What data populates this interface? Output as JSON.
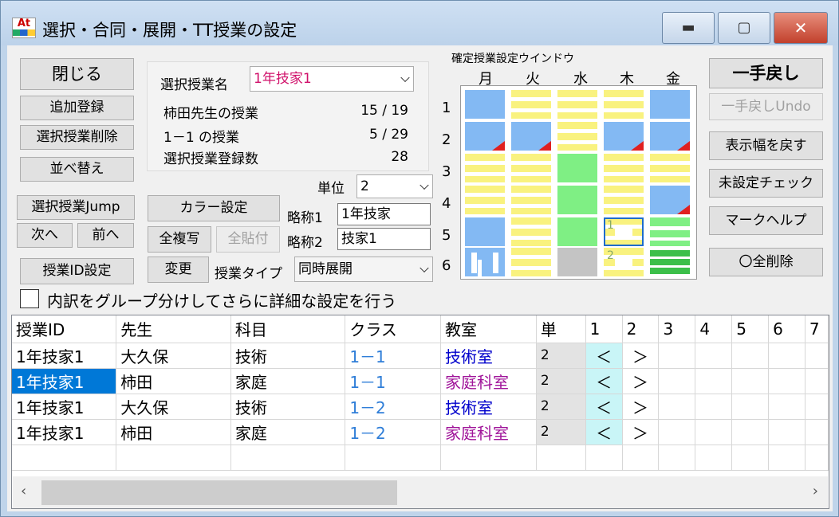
{
  "window": {
    "title": "選択・合同・展開・TT授業の設定",
    "app_icon_text": "At"
  },
  "left_buttons": {
    "close": "閉じる",
    "add": "追加登録",
    "delete": "選択授業削除",
    "sort": "並べ替え",
    "jump": "選択授業Jump",
    "next": "次へ",
    "prev": "前へ",
    "id_setting": "授業ID設定"
  },
  "info": {
    "select_label": "選択授業名",
    "select_value": "1年技家1",
    "row1_label": "柿田先生の授業",
    "row1_value": "15 / 19",
    "row2_label": "1－1 の授業",
    "row2_value": "5 / 29",
    "row3_label": "選択授業登録数",
    "row3_value": "28"
  },
  "mid": {
    "color_btn": "カラー設定",
    "copy_all": "全複写",
    "paste_all": "全貼付",
    "change": "変更",
    "unit_label": "単位",
    "unit_value": "2",
    "abbr1_label": "略称1",
    "abbr1_value": "1年技家",
    "abbr2_label": "略称2",
    "abbr2_value": "技家1",
    "type_label": "授業タイプ",
    "type_value": "同時展開"
  },
  "grid": {
    "title": "確定授業設定ウインドウ",
    "days": [
      "月",
      "火",
      "水",
      "木",
      "金"
    ],
    "periods": [
      "1",
      "2",
      "3",
      "4",
      "5",
      "6"
    ],
    "sel_labels": [
      "1",
      "2"
    ]
  },
  "right_buttons": {
    "undo": "一手戻し",
    "undo_undo": "一手戻しUndo",
    "reset_width": "表示幅を戻す",
    "check": "未設定チェック",
    "mark_help": "マークヘルプ",
    "clear_all": "〇全削除"
  },
  "checkbox_label": "内訳をグループ分けしてさらに詳細な設定を行う",
  "table": {
    "headers": [
      "授業ID",
      "先生",
      "科目",
      "クラス",
      "教室",
      "単",
      "1",
      "2",
      "3",
      "4",
      "5",
      "6",
      "7"
    ],
    "rows": [
      {
        "id": "1年技家1",
        "teacher": "大久保",
        "subject": "技術",
        "class": "1－1",
        "room": "技術室",
        "unit": "2",
        "a": "＜",
        "b": "＞"
      },
      {
        "id": "1年技家1",
        "teacher": "柿田",
        "subject": "家庭",
        "class": "1－1",
        "room": "家庭科室",
        "unit": "2",
        "a": "＜",
        "b": "＞"
      },
      {
        "id": "1年技家1",
        "teacher": "大久保",
        "subject": "技術",
        "class": "1－2",
        "room": "技術室",
        "unit": "2",
        "a": "＜",
        "b": "＞"
      },
      {
        "id": "1年技家1",
        "teacher": "柿田",
        "subject": "家庭",
        "class": "1－2",
        "room": "家庭科室",
        "unit": "2",
        "a": "＜",
        "b": "＞"
      }
    ]
  },
  "colors": {
    "class": "#2f7ed8",
    "room_tech": "#0000cc",
    "room_home": "#a0159a",
    "select_highlight": "#0078d7",
    "combo_text": "#d0106a"
  }
}
